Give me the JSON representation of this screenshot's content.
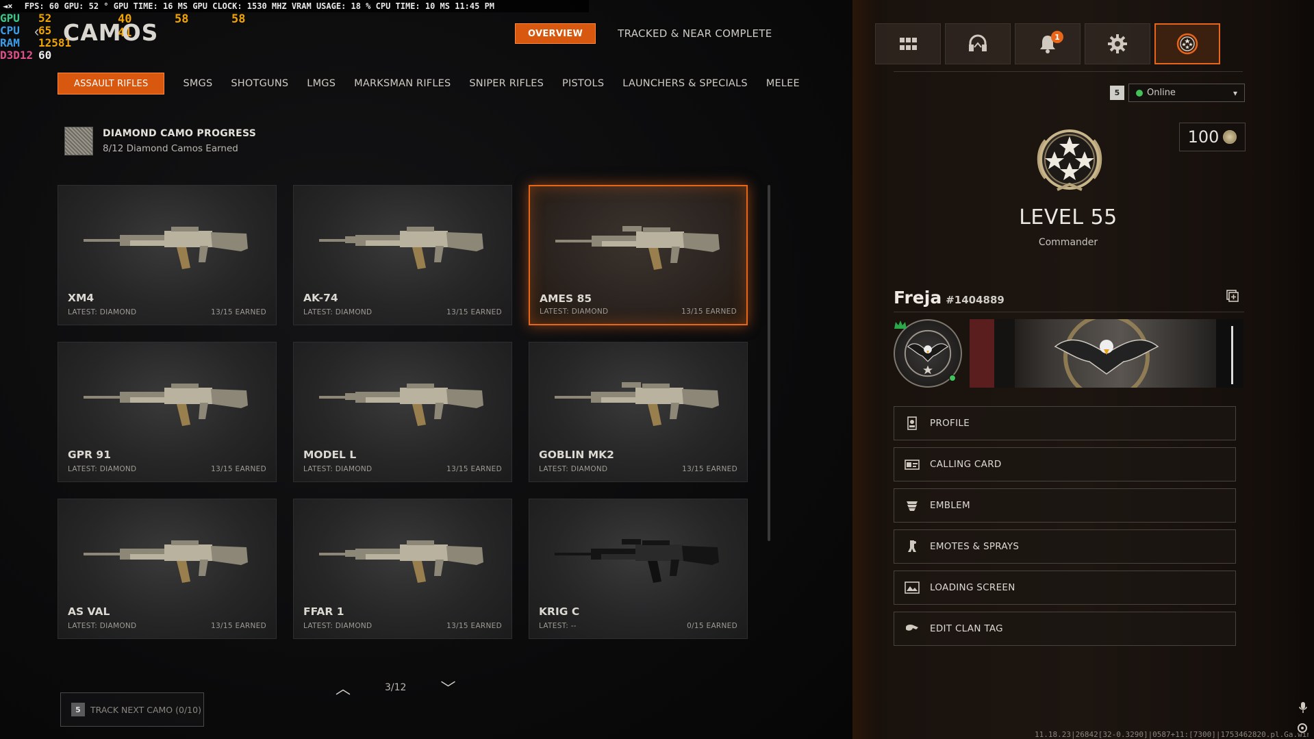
{
  "perf": {
    "top_bar": [
      "FPS:",
      "60",
      "GPU:",
      "52 °",
      "GPU TIME:",
      "16 MS",
      "GPU CLOCK:",
      "1530 MHZ",
      "VRAM USAGE:",
      "18 %",
      "CPU TIME:",
      "10 MS",
      "11:45 PM"
    ],
    "gpu_label": "GPU",
    "gpu_val": "52",
    "cpu_label": "CPU",
    "cpu_val": "65",
    "ram_label": "RAM",
    "ram_val": "12581",
    "d3d_label": "D3D12",
    "d3d_val": "60",
    "float_1": "40",
    "float_2": "58",
    "float_3": "58",
    "float_4": "41"
  },
  "header": {
    "title": "CAMOS",
    "tabs": [
      {
        "label": "OVERVIEW",
        "active": true
      },
      {
        "label": "TRACKED & NEAR COMPLETE",
        "active": false
      }
    ]
  },
  "categories": [
    {
      "label": "ASSAULT RIFLES",
      "active": true
    },
    {
      "label": "SMGS",
      "active": false
    },
    {
      "label": "SHOTGUNS",
      "active": false
    },
    {
      "label": "LMGS",
      "active": false
    },
    {
      "label": "MARKSMAN RIFLES",
      "active": false
    },
    {
      "label": "SNIPER RIFLES",
      "active": false
    },
    {
      "label": "PISTOLS",
      "active": false
    },
    {
      "label": "LAUNCHERS & SPECIALS",
      "active": false
    },
    {
      "label": "MELEE",
      "active": false
    }
  ],
  "progress": {
    "title": "DIAMOND CAMO PROGRESS",
    "subtitle": "8/12 Diamond Camos Earned"
  },
  "weapons": [
    {
      "name": "XM4",
      "latest": "LATEST: DIAMOND",
      "earned": "13/15 EARNED",
      "selected": false,
      "dark": false
    },
    {
      "name": "AK-74",
      "latest": "LATEST: DIAMOND",
      "earned": "13/15 EARNED",
      "selected": false,
      "dark": false
    },
    {
      "name": "AMES 85",
      "latest": "LATEST: DIAMOND",
      "earned": "13/15 EARNED",
      "selected": true,
      "dark": false
    },
    {
      "name": "GPR 91",
      "latest": "LATEST: DIAMOND",
      "earned": "13/15 EARNED",
      "selected": false,
      "dark": false
    },
    {
      "name": "MODEL L",
      "latest": "LATEST: DIAMOND",
      "earned": "13/15 EARNED",
      "selected": false,
      "dark": false
    },
    {
      "name": "GOBLIN MK2",
      "latest": "LATEST: DIAMOND",
      "earned": "13/15 EARNED",
      "selected": false,
      "dark": false
    },
    {
      "name": "AS VAL",
      "latest": "LATEST: DIAMOND",
      "earned": "13/15 EARNED",
      "selected": false,
      "dark": false
    },
    {
      "name": "FFAR 1",
      "latest": "LATEST: DIAMOND",
      "earned": "13/15 EARNED",
      "selected": false,
      "dark": false
    },
    {
      "name": "KRIG C",
      "latest": "LATEST: --",
      "earned": "0/15 EARNED",
      "selected": false,
      "dark": true
    }
  ],
  "pager": {
    "page": "3/12"
  },
  "track": {
    "key": "5",
    "label": "TRACK NEXT CAMO (0/10)"
  },
  "right": {
    "notif_count": "1",
    "status_key": "5",
    "status": "Online",
    "currency": "100",
    "level": "LEVEL 55",
    "rank_title": "Commander",
    "player_name": "Freja",
    "player_tag": "#1404889",
    "menu": [
      {
        "label": "PROFILE",
        "icon": "profile-icon"
      },
      {
        "label": "CALLING CARD",
        "icon": "calling-card-icon"
      },
      {
        "label": "EMBLEM",
        "icon": "emblem-icon"
      },
      {
        "label": "EMOTES & SPRAYS",
        "icon": "emotes-icon"
      },
      {
        "label": "LOADING SCREEN",
        "icon": "loading-screen-icon"
      },
      {
        "label": "EDIT CLAN TAG",
        "icon": "clan-tag-icon"
      }
    ],
    "footer": "11.18.23|26842[32-0.3290]|0587+11:[7300]|1753462820.pl.Ga.win64"
  },
  "colors": {
    "accent": "#e8661a",
    "online": "#42c25a"
  }
}
